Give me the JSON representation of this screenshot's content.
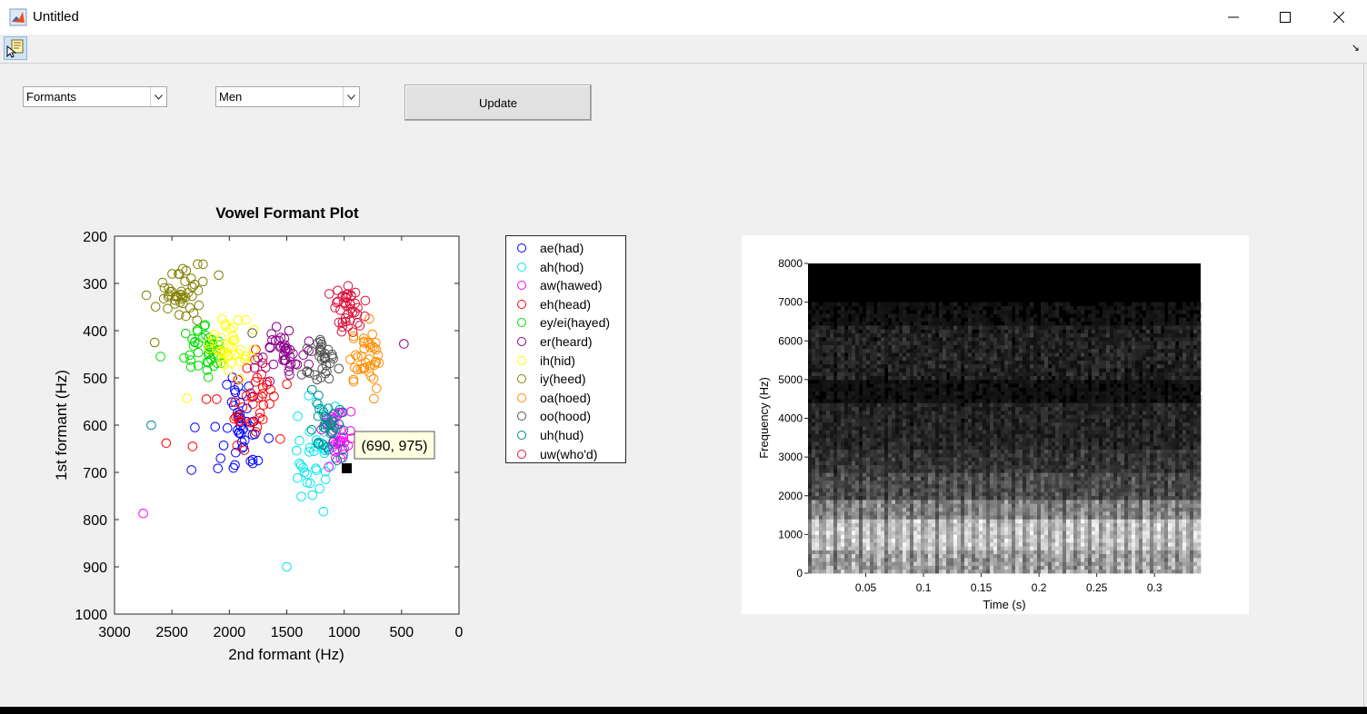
{
  "window": {
    "title": "Untitled",
    "controls": [
      "minimize",
      "maximize",
      "close"
    ]
  },
  "toolbar": {
    "tool_icon": "edit-plot-icon",
    "corner_icon": "↘"
  },
  "controls": {
    "plot_type": {
      "value": "Formants"
    },
    "group": {
      "value": "Men"
    },
    "update_label": "Update"
  },
  "formant_plot": {
    "title": "Vowel Formant Plot",
    "xlabel": "2nd formant (Hz)",
    "ylabel": "1st formant (Hz)",
    "xticks": [
      "3000",
      "2500",
      "2000",
      "1500",
      "1000",
      "500",
      "0"
    ],
    "yticks": [
      "200",
      "300",
      "400",
      "500",
      "600",
      "700",
      "800",
      "900",
      "1000"
    ],
    "datatip": "(690, 975)"
  },
  "legend": [
    {
      "label": "ae(had)",
      "color": "#0000ff"
    },
    {
      "label": "ah(hod)",
      "color": "#00e5ee"
    },
    {
      "label": "aw(hawed)",
      "color": "#ff00ff"
    },
    {
      "label": "eh(head)",
      "color": "#ff0000"
    },
    {
      "label": "ey/ei(hayed)",
      "color": "#00dd00"
    },
    {
      "label": "er(heard)",
      "color": "#8b008b"
    },
    {
      "label": "ih(hid)",
      "color": "#ffff00"
    },
    {
      "label": "iy(heed)",
      "color": "#808000"
    },
    {
      "label": "oa(hoed)",
      "color": "#ff8c00"
    },
    {
      "label": "oo(hood)",
      "color": "#555555"
    },
    {
      "label": "uh(hud)",
      "color": "#008b8b"
    },
    {
      "label": "uw(who'd)",
      "color": "#dc143c"
    }
  ],
  "chart_data": [
    {
      "type": "scatter",
      "title": "Vowel Formant Plot",
      "xlabel": "2nd formant (Hz)",
      "ylabel": "1st formant (Hz)",
      "xlim": [
        3000,
        0
      ],
      "ylim": [
        1000,
        200
      ],
      "x_reversed": true,
      "y_reversed": true,
      "series": [
        {
          "name": "ae(had)",
          "color": "#0000ff",
          "center": [
            1950,
            600
          ],
          "spread": [
            100,
            45
          ],
          "n": 45,
          "extra": [
            [
              2300,
              605
            ],
            [
              2330,
              695
            ],
            [
              1750,
              675
            ]
          ]
        },
        {
          "name": "ah(hod)",
          "color": "#00e5ee",
          "center": [
            1280,
            660
          ],
          "spread": [
            90,
            55
          ],
          "n": 40,
          "extra": [
            [
              1500,
              900
            ],
            [
              1180,
              783
            ]
          ]
        },
        {
          "name": "aw(hawed)",
          "color": "#ff00ff",
          "center": [
            1050,
            620
          ],
          "spread": [
            60,
            30
          ],
          "n": 35,
          "extra": [
            [
              2750,
              787
            ],
            [
              1000,
              650
            ]
          ]
        },
        {
          "name": "eh(head)",
          "color": "#ff0000",
          "center": [
            1800,
            560
          ],
          "spread": [
            110,
            40
          ],
          "n": 40,
          "extra": [
            [
              2550,
              638
            ],
            [
              2320,
              645
            ],
            [
              2200,
              545
            ],
            [
              2110,
              545
            ]
          ]
        },
        {
          "name": "ey/ei(hayed)",
          "color": "#00dd00",
          "center": [
            2250,
            430
          ],
          "spread": [
            90,
            30
          ],
          "n": 40,
          "extra": [
            [
              2600,
              455
            ]
          ]
        },
        {
          "name": "er(heard)",
          "color": "#8b008b",
          "center": [
            1530,
            455
          ],
          "spread": [
            120,
            22
          ],
          "n": 40,
          "extra": [
            [
              480,
              428
            ],
            [
              1480,
              400
            ]
          ]
        },
        {
          "name": "ih(hid)",
          "color": "#ffff00",
          "center": [
            1990,
            430
          ],
          "spread": [
            110,
            35
          ],
          "n": 40,
          "extra": [
            [
              2370,
              543
            ]
          ]
        },
        {
          "name": "iy(heed)",
          "color": "#808000",
          "center": [
            2420,
            320
          ],
          "spread": [
            130,
            28
          ],
          "n": 45,
          "extra": [
            [
              2650,
              425
            ]
          ]
        },
        {
          "name": "oa(hoed)",
          "color": "#ff8c00",
          "center": [
            820,
            450
          ],
          "spread": [
            70,
            30
          ],
          "n": 40,
          "extra": []
        },
        {
          "name": "oo(hood)",
          "color": "#555555",
          "center": [
            1200,
            462
          ],
          "spread": [
            80,
            25
          ],
          "n": 35,
          "extra": [
            [
              1800,
              405
            ]
          ]
        },
        {
          "name": "uh(hud)",
          "color": "#008b8b",
          "center": [
            1140,
            600
          ],
          "spread": [
            60,
            35
          ],
          "n": 35,
          "extra": [
            [
              2680,
              600
            ],
            [
              1280,
              525
            ]
          ]
        },
        {
          "name": "uw(who'd)",
          "color": "#dc143c",
          "center": [
            970,
            355
          ],
          "spread": [
            60,
            25
          ],
          "n": 40,
          "extra": [
            [
              1130,
              322
            ]
          ]
        }
      ]
    },
    {
      "type": "heatmap",
      "title": "",
      "xlabel": "Time (s)",
      "ylabel": "Frequency (Hz)",
      "xlim": [
        0,
        0.34
      ],
      "ylim": [
        0,
        8000
      ],
      "xticks": [
        "0.05",
        "0.1",
        "0.15",
        "0.2",
        "0.25",
        "0.3"
      ],
      "yticks": [
        "0",
        "1000",
        "2000",
        "3000",
        "4000",
        "5000",
        "6000",
        "7000",
        "8000"
      ],
      "colormap": "gray"
    }
  ]
}
